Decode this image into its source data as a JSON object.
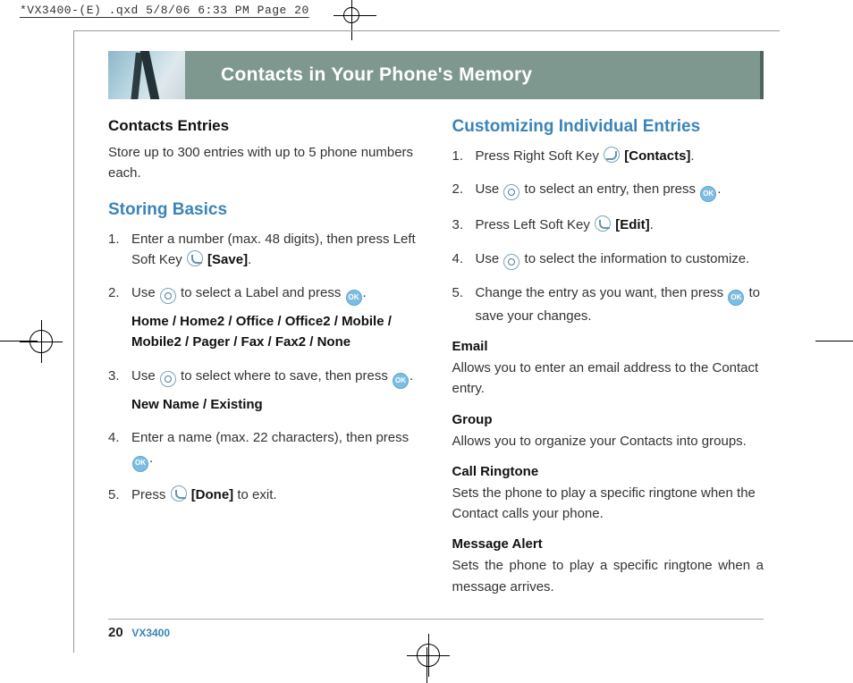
{
  "doc_header": "*VX3400-(E) .qxd  5/8/06  6:33 PM  Page 20",
  "page_title": "Contacts in Your Phone's Memory",
  "left": {
    "section_title": "Contacts Entries",
    "section_text": "Store up to 300 entries with up to 5 phone numbers each.",
    "heading": "Storing Basics",
    "steps": {
      "s1a": "Enter a number (max. 48 digits), then press Left Soft Key",
      "s1b": "[Save]",
      "s1c": ".",
      "s2a": "Use",
      "s2b": "to select a Label and press",
      "s2c": ".",
      "s2_sub": "Home / Home2 / Office / Office2 / Mobile / Mobile2 / Pager / Fax / Fax2 / None",
      "s3a": "Use",
      "s3b": "to select where to save, then press",
      "s3c": ".",
      "s3_sub": "New Name / Existing",
      "s4a": "Enter a name (max. 22 characters), then press",
      "s4b": ".",
      "s5a": "Press",
      "s5b": "[Done]",
      "s5c": " to exit."
    }
  },
  "right": {
    "heading": "Customizing Individual Entries",
    "steps": {
      "s1a": "Press Right Soft Key",
      "s1b": "[Contacts]",
      "s1c": ".",
      "s2a": "Use",
      "s2b": "to select an entry, then press",
      "s2c": ".",
      "s3a": "Press Left Soft Key",
      "s3b": "[Edit]",
      "s3c": ".",
      "s4a": "Use",
      "s4b": "to select the information to customize.",
      "s5a": "Change the entry as you want, then press",
      "s5b": "to save your changes."
    },
    "fields": {
      "email_h": "Email",
      "email_t": "Allows you to enter an email address to the Contact entry.",
      "group_h": "Group",
      "group_t": "Allows you to organize your Contacts into groups.",
      "ring_h": "Call Ringtone",
      "ring_t": "Sets the phone to play a specific ringtone when the Contact calls your phone.",
      "msg_h": "Message Alert",
      "msg_t": "Sets the phone to play a specific ringtone when a message arrives."
    }
  },
  "footer": {
    "page_number": "20",
    "model": "VX3400"
  },
  "icons": {
    "ok_label": "OK"
  }
}
